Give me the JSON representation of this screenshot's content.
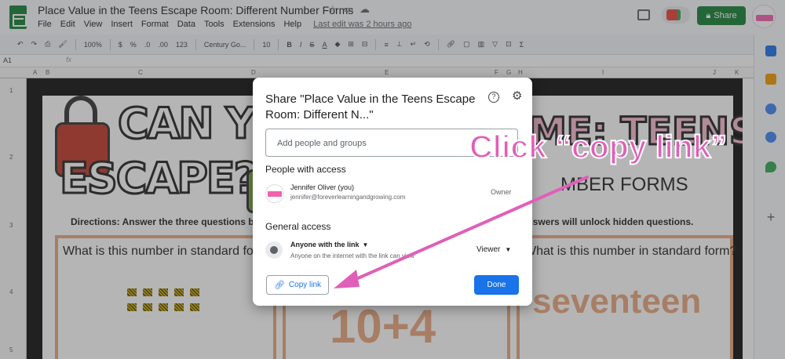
{
  "titlebar": {
    "doc_title": "Place Value in the Teens Escape Room: Different Number Forms",
    "share_label": "Share",
    "menu": [
      "File",
      "Edit",
      "View",
      "Insert",
      "Format",
      "Data",
      "Tools",
      "Extensions",
      "Help"
    ],
    "last_edit": "Last edit was 2 hours ago"
  },
  "toolbar": {
    "zoom": "100%",
    "currency": "$",
    "percent": "%",
    "decimal_dec": ".0",
    "decimal_inc": ".00",
    "number_format": "123",
    "font": "Century Go...",
    "font_size": "10",
    "bold": "B",
    "italic": "I",
    "strike": "S",
    "text_color": "A"
  },
  "formula_bar": {
    "cell_ref": "A1",
    "fx": "fx"
  },
  "grid": {
    "columns": [
      "A",
      "B",
      "C",
      "D",
      "E",
      "F",
      "G",
      "H",
      "I",
      "J",
      "K"
    ],
    "rows": [
      "1",
      "2",
      "3",
      "4",
      "5"
    ]
  },
  "sheet_content": {
    "can_you": "CAN YOU",
    "escape": "ESCAPE?",
    "teens_fragment": "ME: TEENS",
    "forms_fragment": "MBER FORMS",
    "directions_left": "Directions:  Answer the three questions b",
    "directions_right": "ect answers will unlock hidden questions.",
    "question_left": "What is this number in standard form",
    "question_right": "What is this number in standard form?",
    "mid_number": "10+4",
    "word_number": "seventeen"
  },
  "dialog": {
    "title": "Share \"Place Value in the Teens Escape Room: Different N...\"",
    "add_people_placeholder": "Add people and groups",
    "people_with_access": "People with access",
    "person_name": "Jennifer Oliver (you)",
    "person_email": "jennifer@foreverlearningandgrowing.com",
    "person_role": "Owner",
    "general_access": "General access",
    "access_setting": "Anyone with the link",
    "access_description": "Anyone on the internet with the link can view",
    "access_role": "Viewer",
    "copy_link": "Copy link",
    "done": "Done"
  },
  "annotation": {
    "text": "Click “copy link”",
    "color": "#e05fb8"
  },
  "colors": {
    "accent": "#1a73e8",
    "share_green": "#188038",
    "sheet_orange": "#e8a77f"
  }
}
